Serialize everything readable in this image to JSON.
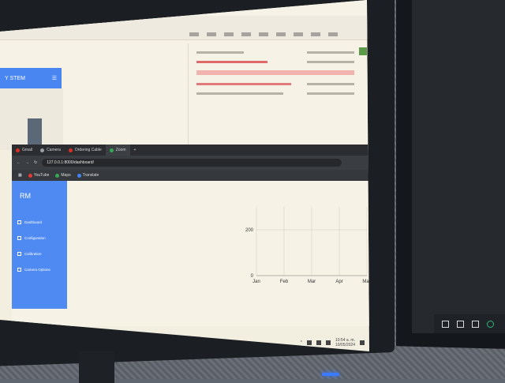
{
  "browser": {
    "tabs": [
      {
        "label": "Gmail",
        "color": "#d93025",
        "active": false
      },
      {
        "label": "Camera",
        "color": "#9aa0a6",
        "active": false
      },
      {
        "label": "Ordering Cable",
        "color": "#d93025",
        "active": false
      },
      {
        "label": "Zoom",
        "color": "#34a853",
        "active": true
      }
    ],
    "url": "127.0.0.1:8000/dashboard/",
    "bookmarks": [
      {
        "label": "YouTube",
        "color": "#e53935"
      },
      {
        "label": "Maps",
        "color": "#34a853"
      },
      {
        "label": "Translate",
        "color": "#4285f4"
      }
    ]
  },
  "bg_window": {
    "title": "Y STEM"
  },
  "app": {
    "brand": "RM",
    "nav": [
      {
        "label": "Dashboard"
      },
      {
        "label": "Configuration"
      },
      {
        "label": "Calibration"
      },
      {
        "label": "Camera Options"
      }
    ]
  },
  "chart_data": {
    "type": "line",
    "categories": [
      "Jan",
      "Feb",
      "Mar",
      "Apr",
      "May"
    ],
    "y_ticks": [
      0,
      200
    ],
    "ylim": [
      0,
      300
    ],
    "series": [],
    "grid": true
  },
  "taskbar": {
    "time": "10:54 a. m.",
    "date": "10/05/2024"
  },
  "colors": {
    "sidebar": "#4f8af3",
    "tabbar": "#2b2d30",
    "led": "#3a7bff"
  }
}
